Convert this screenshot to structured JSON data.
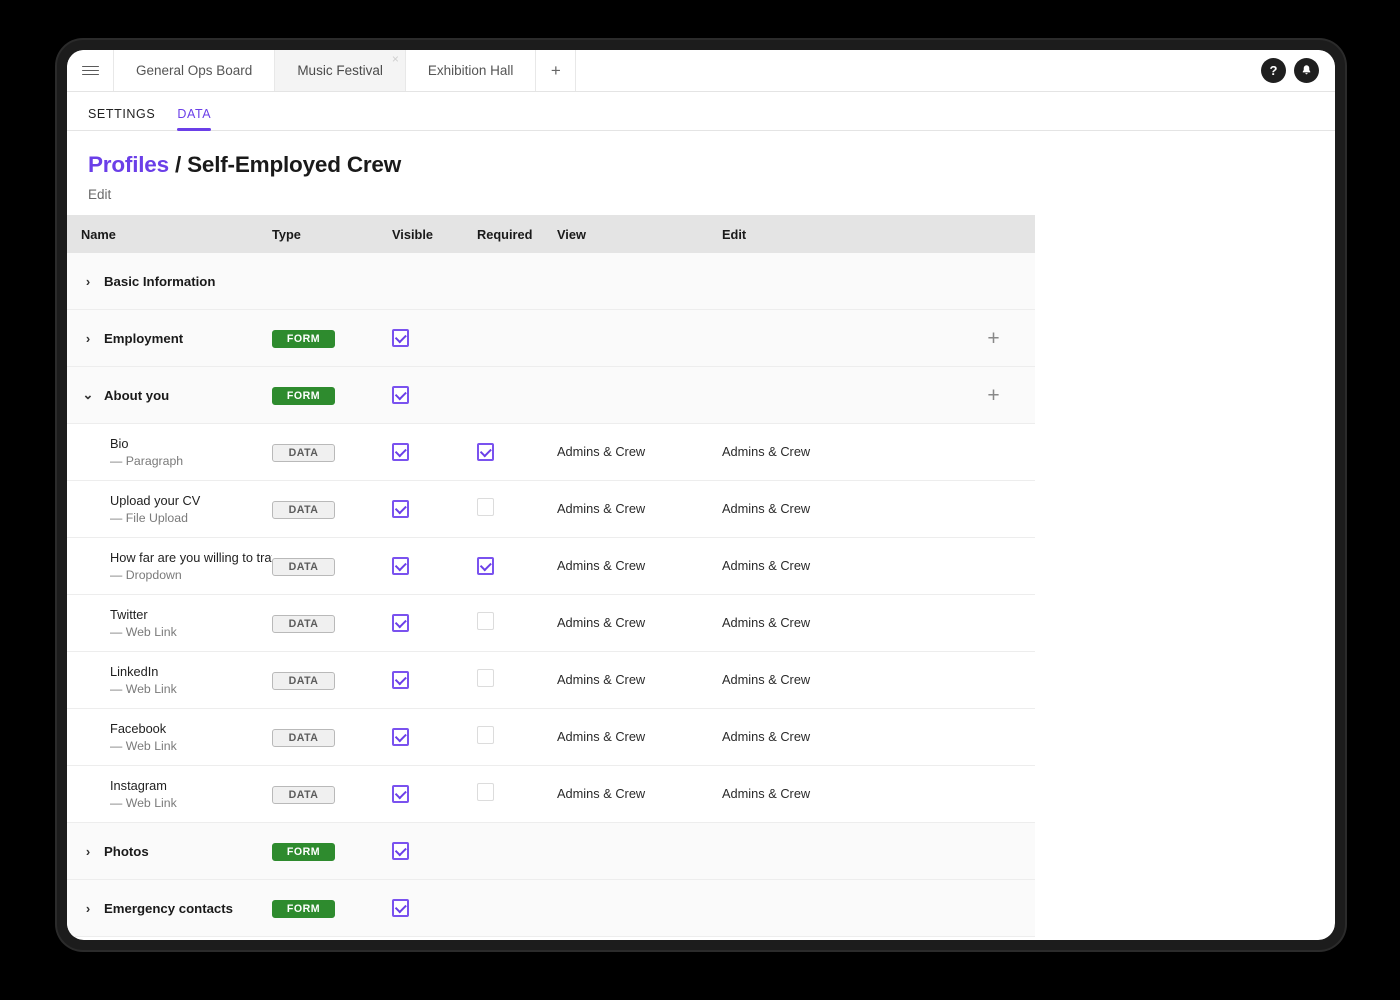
{
  "topbar": {
    "menu_icon": "hamburger-menu-icon",
    "tabs": [
      {
        "label": "General Ops Board",
        "active": false,
        "closable": false
      },
      {
        "label": "Music Festival",
        "active": true,
        "closable": true,
        "close_glyph": "×"
      },
      {
        "label": "Exhibition Hall",
        "active": false,
        "closable": false
      }
    ],
    "add_tab_label": "+",
    "help_label": "?",
    "notifications_label": "▲"
  },
  "section_tabs": [
    {
      "label": "SETTINGS",
      "active": false
    },
    {
      "label": "DATA",
      "active": true
    }
  ],
  "heading": {
    "crumb_parent": "Profiles",
    "crumb_separator": " / ",
    "crumb_current": "Self-Employed Crew",
    "subtitle": "Edit",
    "accent_color": "#6b3fe8"
  },
  "table": {
    "columns": [
      "Name",
      "Type",
      "Visible",
      "Required",
      "View",
      "Edit"
    ],
    "rows": [
      {
        "kind": "section",
        "name": "Basic Information",
        "chevron": "›",
        "expanded": false,
        "type_badge": "",
        "visible": "none",
        "required": "none",
        "view": "",
        "edit": "",
        "add": false
      },
      {
        "kind": "section",
        "name": "Employment",
        "chevron": "›",
        "expanded": false,
        "type_badge": "FORM",
        "visible": "checked",
        "required": "none",
        "view": "",
        "edit": "",
        "add": true
      },
      {
        "kind": "section",
        "name": "About you",
        "chevron": "⌄",
        "expanded": true,
        "type_badge": "FORM",
        "visible": "checked",
        "required": "none",
        "view": "",
        "edit": "",
        "add": true
      },
      {
        "kind": "field",
        "name": "Bio",
        "subtype": "— Paragraph",
        "type_badge": "DATA",
        "visible": "checked",
        "required": "checked",
        "view": "Admins & Crew",
        "edit": "Admins & Crew",
        "add": false
      },
      {
        "kind": "field",
        "name": "Upload your CV",
        "subtype": "— File Upload",
        "type_badge": "DATA",
        "visible": "checked",
        "required": "unchecked",
        "view": "Admins & Crew",
        "edit": "Admins & Crew",
        "add": false
      },
      {
        "kind": "field",
        "name": "How far are you willing to travel",
        "subtype": "— Dropdown",
        "type_badge": "DATA",
        "visible": "checked",
        "required": "checked",
        "view": "Admins & Crew",
        "edit": "Admins & Crew",
        "add": false
      },
      {
        "kind": "field",
        "name": "Twitter",
        "subtype": "— Web Link",
        "type_badge": "DATA",
        "visible": "checked",
        "required": "unchecked",
        "view": "Admins & Crew",
        "edit": "Admins & Crew",
        "add": false
      },
      {
        "kind": "field",
        "name": "LinkedIn",
        "subtype": "— Web Link",
        "type_badge": "DATA",
        "visible": "checked",
        "required": "unchecked",
        "view": "Admins & Crew",
        "edit": "Admins & Crew",
        "add": false
      },
      {
        "kind": "field",
        "name": "Facebook",
        "subtype": "— Web Link",
        "type_badge": "DATA",
        "visible": "checked",
        "required": "unchecked",
        "view": "Admins & Crew",
        "edit": "Admins & Crew",
        "add": false
      },
      {
        "kind": "field",
        "name": "Instagram",
        "subtype": "— Web Link",
        "type_badge": "DATA",
        "visible": "checked",
        "required": "unchecked",
        "view": "Admins & Crew",
        "edit": "Admins & Crew",
        "add": false
      },
      {
        "kind": "section",
        "name": "Photos",
        "chevron": "›",
        "expanded": false,
        "type_badge": "FORM",
        "visible": "checked",
        "required": "none",
        "view": "",
        "edit": "",
        "add": false
      },
      {
        "kind": "section",
        "name": "Emergency contacts",
        "chevron": "›",
        "expanded": false,
        "type_badge": "FORM",
        "visible": "checked",
        "required": "none",
        "view": "",
        "edit": "",
        "add": false
      }
    ]
  },
  "colors": {
    "accent_purple": "#6b3fe8",
    "form_green": "#2e8b2e",
    "header_gray": "#e4e4e4"
  }
}
